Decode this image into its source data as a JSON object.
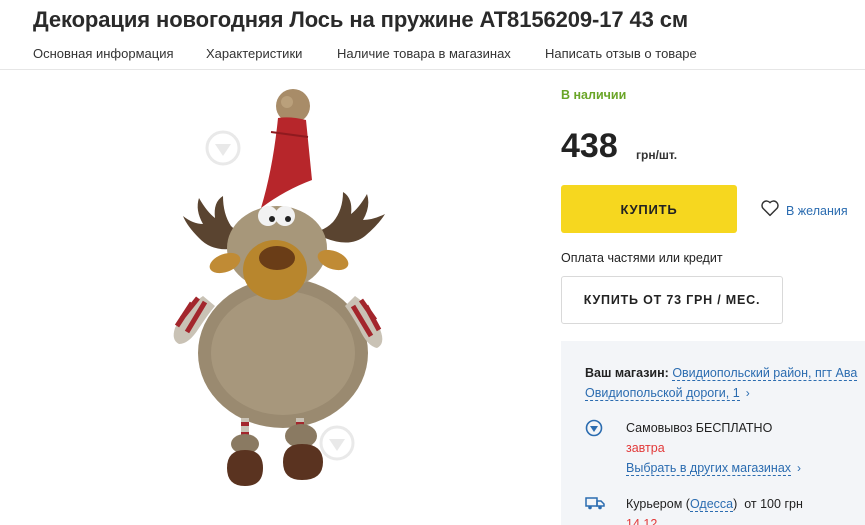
{
  "product": {
    "title": "Декорация новогодняя Лось на пружине AT8156209-17 43 см"
  },
  "tabs": [
    {
      "label": "Основная информация"
    },
    {
      "label": "Характеристики"
    },
    {
      "label": "Наличие товара в магазинах"
    },
    {
      "label": "Написать отзыв о товаре"
    }
  ],
  "offer": {
    "stock_status": "В наличии",
    "price": "438",
    "price_unit": "грн/шт.",
    "buy_label": "КУПИТЬ",
    "wishlist_label": "В желания",
    "installment_text": "Оплата частями или кредит",
    "credit_button_label": "КУПИТЬ ОТ 73 ГРН / МЕС."
  },
  "delivery": {
    "store_label": "Ваш магазин:",
    "store_link_part1": "Овидиопольский район, пгт Ава",
    "store_link_part2": "Овидиопольской дороги, 1",
    "pickup_title": "Самовывоз БЕСПЛАТНО",
    "pickup_when": "завтра",
    "pickup_other_link": "Выбрать в других магазинах",
    "courier_label": "Курьером (",
    "courier_city": "Одесса",
    "courier_close": ")",
    "courier_price": "от 100 грн",
    "courier_when": "14.12"
  },
  "icons": {
    "wishlist": "heart-outline-icon",
    "pickup": "location-pin-icon",
    "courier": "delivery-truck-icon",
    "chevron": "chevron-right-icon"
  },
  "colors": {
    "accent_yellow": "#f6d71f",
    "stock_green": "#6aa527",
    "link_blue": "#2b6cb0",
    "alert_red": "#e23a3a",
    "panel_bg": "#f3f5f8"
  }
}
